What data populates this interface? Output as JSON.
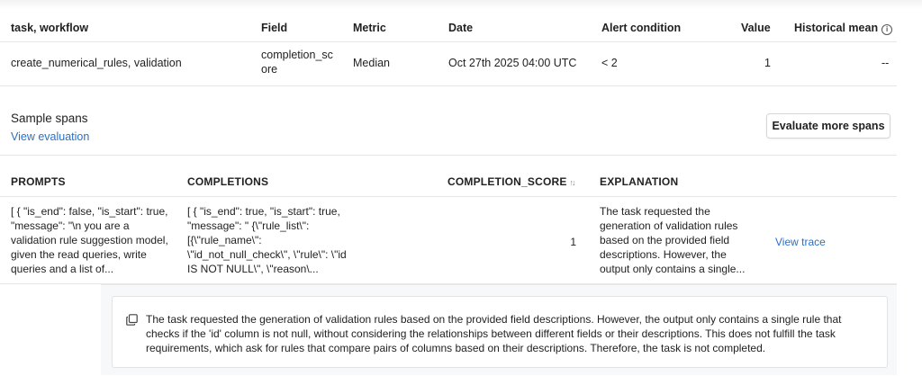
{
  "alerts": {
    "columns": {
      "task": "task, workflow",
      "field": "Field",
      "metric": "Metric",
      "date": "Date",
      "condition": "Alert condition",
      "value": "Value",
      "hist_mean": "Historical mean"
    },
    "row": {
      "task": "create_numerical_rules, validation",
      "field": "completion_score",
      "metric": "Median",
      "date": "Oct 27th 2025 04:00 UTC",
      "condition": "< 2",
      "value": "1",
      "hist_mean": "--"
    },
    "info_icon": "info-icon"
  },
  "sample_spans": {
    "title": "Sample spans",
    "view_evaluation": "View evaluation",
    "evaluate_button": "Evaluate more spans"
  },
  "spans_table": {
    "columns": {
      "prompts": "PROMPTS",
      "completions": "COMPLETIONS",
      "score": "COMPLETION_SCORE",
      "explanation": "EXPLANATION"
    },
    "sort_icon": "sort-icon",
    "rows": [
      {
        "prompt": "[ { \"is_end\": false, \"is_start\": true, \"message\": \"\\n you are a validation rule suggestion model, given the read queries, write queries and a list of...",
        "completion": "[ { \"is_end\": true, \"is_start\": true, \"message\": \" {\\\"rule_list\\\": [{\\\"rule_name\\\": \\\"id_not_null_check\\\", \\\"rule\\\": \\\"id IS NOT NULL\\\", \\\"reason\\...",
        "score": "1",
        "explanation": "The task requested the generation of validation rules based on the provided field descriptions. However, the output only contains a single...",
        "view_trace": "View trace"
      }
    ]
  },
  "expanded_explanation": {
    "copy_icon": "copy-icon",
    "text": "The task requested the generation of validation rules based on the provided field descriptions. However, the output only contains a single rule that checks if the 'id' column is not null, without considering the relationships between different fields or their descriptions. This does not fulfill the task requirements, which ask for rules that compare pairs of columns based on their descriptions. Therefore, the task is not completed."
  },
  "colors": {
    "link": "#2a6fc9",
    "border": "#e6e6e6",
    "text": "#222222",
    "panel_bg": "#f7f8f9"
  }
}
